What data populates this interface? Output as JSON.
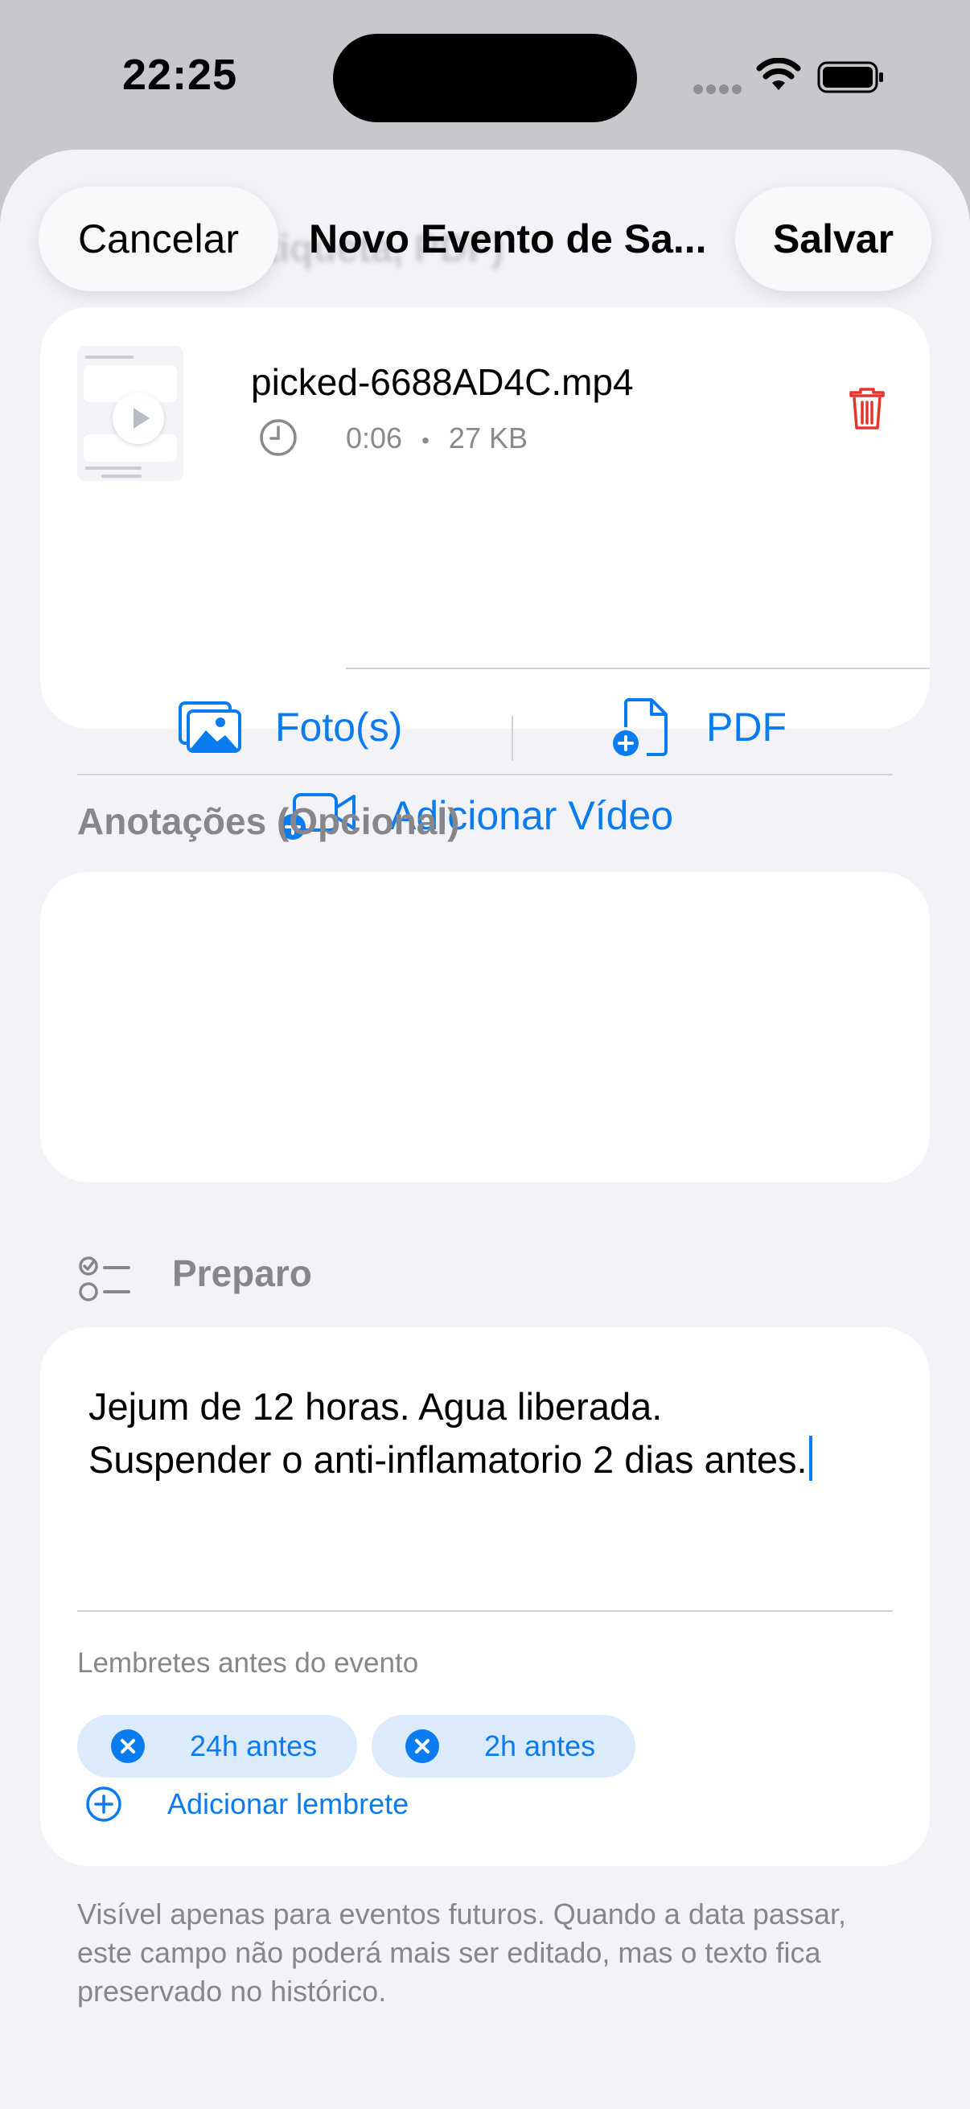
{
  "status_bar": {
    "time": "22:25"
  },
  "nav": {
    "cancel_label": "Cancelar",
    "title": "Novo Evento de Sa...",
    "save_label": "Salvar",
    "ghost_title": "Anexos (Etiqueta, PDF)"
  },
  "attachment": {
    "file_name": "picked-6688AD4C.mp4",
    "duration": "0:06",
    "separator": "•",
    "size": "27 KB"
  },
  "media_actions": {
    "photos_label": "Foto(s)",
    "pdf_label": "PDF",
    "video_label": "Adicionar Vídeo"
  },
  "notes": {
    "section_label": "Anotações (Opcional)",
    "value": ""
  },
  "preparation": {
    "section_label": "Preparo",
    "lines": [
      "Jejum de 12 horas. Agua liberada.",
      "Suspender o anti-inflamatorio 2 dias antes."
    ],
    "reminders_label": "Lembretes antes do evento",
    "reminders": [
      "24h antes",
      "2h antes"
    ],
    "add_reminder_label": "Adicionar lembrete"
  },
  "footer_note": "Visível apenas para eventos futuros. Quando a data passar, este campo não poderá mais ser editado, mas o texto fica preservado no histórico.",
  "colors": {
    "accent": "#0A7CF0",
    "destructive": "#E5342E",
    "background": "#F2F2F7",
    "secondary_text": "#86868B"
  },
  "icons": {
    "trash": "trash-icon",
    "photos": "photos-icon",
    "pdf": "pdf-add-icon",
    "video": "video-add-icon",
    "checklist": "checklist-icon",
    "clock": "clock-icon"
  }
}
